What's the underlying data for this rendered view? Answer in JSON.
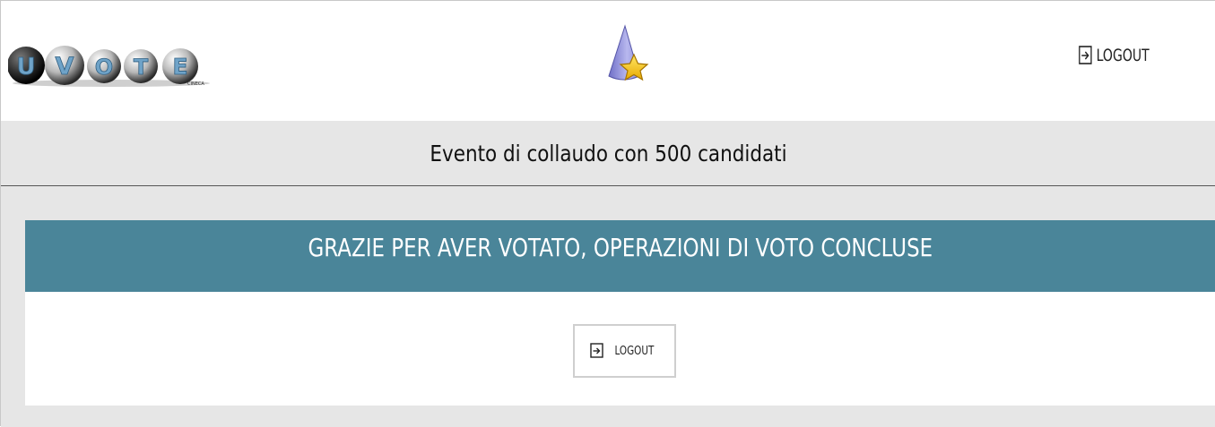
{
  "header": {
    "logo_letters": [
      "U",
      "V",
      "O",
      "T",
      "E"
    ],
    "logo_sub": "CINECA",
    "logout_label": "LOGOUT",
    "logout_icon": "logout-icon",
    "center_icon": "cone-star-icon"
  },
  "event": {
    "title": "Evento di collaudo con 500 candidati"
  },
  "main": {
    "thanks_message": "GRAZIE PER AVER VOTATO, OPERAZIONI DI VOTO CONCLUSE",
    "logout_button_label": "LOGOUT"
  },
  "colors": {
    "banner": "#4a8599",
    "band_bg": "#e6e6e6"
  }
}
